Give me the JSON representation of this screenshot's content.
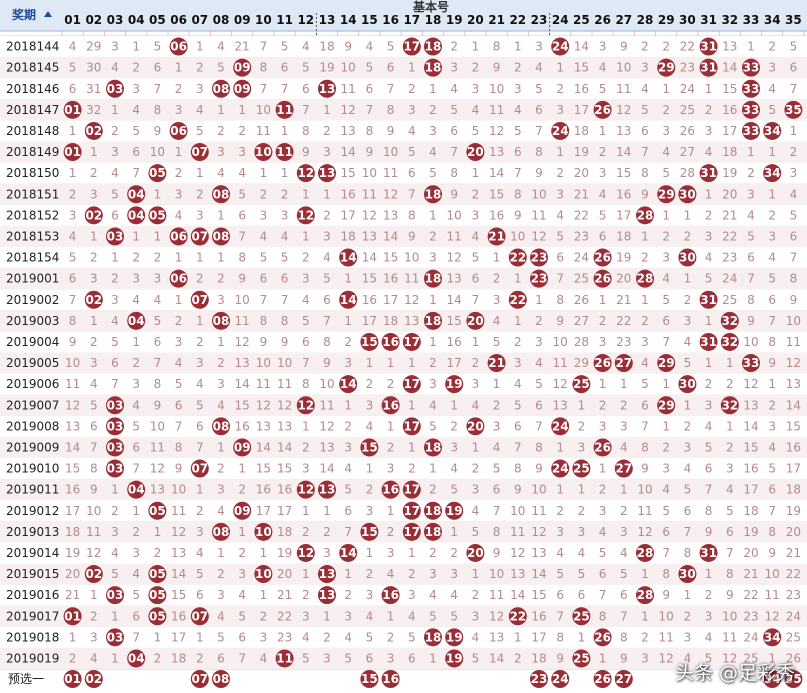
{
  "header": {
    "period_label": "奖期",
    "sort_icon": "sort-asc-icon",
    "base_label": "基本号",
    "columns": [
      "01",
      "02",
      "03",
      "04",
      "05",
      "06",
      "07",
      "08",
      "09",
      "10",
      "11",
      "12",
      "13",
      "14",
      "15",
      "16",
      "17",
      "18",
      "19",
      "20",
      "21",
      "22",
      "23",
      "24",
      "25",
      "26",
      "27",
      "28",
      "29",
      "30",
      "31",
      "32",
      "33",
      "34",
      "35"
    ]
  },
  "colors": {
    "ball": "#9a2e36",
    "header_bg": "#dfe9f6",
    "row_alt": "#f7eff0",
    "miss_text": "#b58a8d"
  },
  "rows": [
    {
      "period": "2018144",
      "cells": [
        4,
        29,
        3,
        1,
        5,
        0,
        1,
        4,
        21,
        7,
        5,
        4,
        18,
        9,
        4,
        5,
        0,
        0,
        2,
        1,
        8,
        1,
        3,
        0,
        14,
        3,
        9,
        2,
        2,
        22,
        0,
        13,
        1,
        2,
        5
      ]
    },
    {
      "period": "2018145",
      "cells": [
        5,
        30,
        4,
        2,
        6,
        1,
        2,
        5,
        0,
        8,
        6,
        5,
        19,
        10,
        5,
        6,
        1,
        0,
        3,
        2,
        9,
        2,
        4,
        1,
        15,
        4,
        10,
        3,
        0,
        23,
        0,
        14,
        0,
        3,
        6
      ]
    },
    {
      "period": "2018146",
      "cells": [
        6,
        31,
        0,
        3,
        7,
        2,
        3,
        0,
        0,
        7,
        7,
        6,
        0,
        11,
        6,
        7,
        2,
        1,
        4,
        3,
        10,
        3,
        5,
        2,
        16,
        5,
        11,
        4,
        1,
        24,
        1,
        15,
        0,
        4,
        7
      ]
    },
    {
      "period": "2018147",
      "cells": [
        0,
        32,
        1,
        4,
        8,
        3,
        4,
        1,
        1,
        10,
        0,
        7,
        1,
        12,
        7,
        8,
        3,
        2,
        5,
        4,
        11,
        4,
        6,
        3,
        17,
        0,
        12,
        5,
        2,
        25,
        2,
        16,
        0,
        5,
        0
      ]
    },
    {
      "period": "2018148",
      "cells": [
        1,
        0,
        2,
        5,
        9,
        0,
        5,
        2,
        2,
        11,
        1,
        8,
        2,
        13,
        8,
        9,
        4,
        3,
        6,
        5,
        12,
        5,
        7,
        0,
        18,
        1,
        13,
        6,
        3,
        26,
        3,
        17,
        0,
        0,
        1
      ]
    },
    {
      "period": "2018149",
      "cells": [
        0,
        1,
        3,
        6,
        10,
        1,
        0,
        3,
        3,
        0,
        0,
        9,
        3,
        14,
        9,
        10,
        5,
        4,
        7,
        0,
        13,
        6,
        8,
        1,
        19,
        2,
        14,
        7,
        4,
        27,
        4,
        18,
        1,
        1,
        2
      ]
    },
    {
      "period": "2018150",
      "cells": [
        1,
        2,
        4,
        7,
        0,
        2,
        1,
        4,
        4,
        1,
        1,
        0,
        0,
        15,
        10,
        11,
        6,
        5,
        8,
        1,
        14,
        7,
        9,
        2,
        20,
        3,
        15,
        8,
        5,
        28,
        0,
        19,
        2,
        0,
        3
      ]
    },
    {
      "period": "2018151",
      "cells": [
        2,
        3,
        5,
        0,
        1,
        3,
        2,
        0,
        5,
        2,
        2,
        1,
        1,
        16,
        11,
        12,
        7,
        0,
        9,
        2,
        15,
        8,
        10,
        3,
        21,
        4,
        16,
        9,
        0,
        0,
        1,
        20,
        3,
        1,
        4
      ]
    },
    {
      "period": "2018152",
      "cells": [
        3,
        0,
        6,
        0,
        0,
        4,
        3,
        1,
        6,
        3,
        3,
        0,
        2,
        17,
        12,
        13,
        8,
        1,
        10,
        3,
        16,
        9,
        11,
        4,
        22,
        5,
        17,
        0,
        1,
        1,
        2,
        21,
        4,
        2,
        5
      ]
    },
    {
      "period": "2018153",
      "cells": [
        4,
        1,
        0,
        1,
        1,
        0,
        0,
        0,
        7,
        4,
        4,
        1,
        3,
        18,
        13,
        14,
        9,
        2,
        11,
        4,
        0,
        10,
        12,
        5,
        23,
        6,
        18,
        1,
        2,
        2,
        3,
        22,
        5,
        3,
        6
      ]
    },
    {
      "period": "2018154",
      "cells": [
        5,
        2,
        1,
        2,
        2,
        1,
        1,
        1,
        8,
        5,
        5,
        2,
        4,
        0,
        14,
        15,
        10,
        3,
        12,
        5,
        1,
        0,
        0,
        6,
        24,
        0,
        19,
        2,
        3,
        0,
        4,
        23,
        6,
        4,
        7
      ]
    },
    {
      "period": "2019001",
      "cells": [
        6,
        3,
        2,
        3,
        3,
        0,
        2,
        2,
        9,
        6,
        6,
        3,
        5,
        1,
        15,
        16,
        11,
        0,
        13,
        6,
        2,
        1,
        0,
        7,
        25,
        0,
        20,
        0,
        4,
        1,
        5,
        24,
        7,
        5,
        8
      ]
    },
    {
      "period": "2019002",
      "cells": [
        7,
        0,
        3,
        4,
        4,
        1,
        0,
        3,
        10,
        7,
        7,
        4,
        6,
        0,
        16,
        17,
        12,
        1,
        14,
        7,
        3,
        0,
        1,
        8,
        26,
        1,
        21,
        1,
        5,
        2,
        0,
        25,
        8,
        6,
        9
      ]
    },
    {
      "period": "2019003",
      "cells": [
        8,
        1,
        4,
        0,
        5,
        2,
        1,
        0,
        11,
        8,
        8,
        5,
        7,
        1,
        17,
        18,
        13,
        0,
        15,
        0,
        4,
        1,
        2,
        9,
        27,
        2,
        22,
        2,
        6,
        3,
        1,
        0,
        9,
        7,
        10
      ]
    },
    {
      "period": "2019004",
      "cells": [
        9,
        2,
        5,
        1,
        6,
        3,
        2,
        1,
        12,
        9,
        9,
        6,
        8,
        2,
        0,
        0,
        0,
        1,
        16,
        1,
        5,
        2,
        3,
        10,
        28,
        3,
        23,
        3,
        7,
        4,
        0,
        0,
        10,
        8,
        11
      ]
    },
    {
      "period": "2019005",
      "cells": [
        10,
        3,
        6,
        2,
        7,
        4,
        3,
        2,
        13,
        10,
        10,
        7,
        9,
        3,
        1,
        1,
        1,
        2,
        17,
        2,
        0,
        3,
        4,
        11,
        29,
        0,
        0,
        4,
        0,
        5,
        1,
        1,
        0,
        9,
        12
      ]
    },
    {
      "period": "2019006",
      "cells": [
        11,
        4,
        7,
        3,
        8,
        5,
        4,
        3,
        14,
        11,
        11,
        8,
        10,
        0,
        2,
        2,
        0,
        3,
        0,
        3,
        1,
        4,
        5,
        12,
        0,
        1,
        1,
        5,
        1,
        0,
        2,
        2,
        12,
        1,
        13
      ]
    },
    {
      "period": "2019007",
      "cells": [
        12,
        5,
        0,
        4,
        9,
        6,
        5,
        4,
        15,
        12,
        12,
        0,
        11,
        1,
        3,
        0,
        1,
        4,
        1,
        4,
        2,
        5,
        6,
        13,
        1,
        2,
        2,
        6,
        0,
        1,
        3,
        0,
        13,
        2,
        14
      ]
    },
    {
      "period": "2019008",
      "cells": [
        13,
        6,
        0,
        5,
        10,
        7,
        6,
        0,
        16,
        13,
        13,
        1,
        12,
        2,
        4,
        1,
        0,
        5,
        2,
        0,
        3,
        6,
        7,
        0,
        2,
        3,
        3,
        7,
        1,
        2,
        4,
        1,
        14,
        3,
        15
      ]
    },
    {
      "period": "2019009",
      "cells": [
        14,
        7,
        0,
        6,
        11,
        8,
        7,
        1,
        0,
        14,
        14,
        2,
        13,
        3,
        0,
        2,
        1,
        0,
        3,
        1,
        4,
        7,
        8,
        1,
        3,
        0,
        4,
        8,
        2,
        3,
        5,
        2,
        15,
        4,
        16
      ]
    },
    {
      "period": "2019010",
      "cells": [
        15,
        8,
        0,
        7,
        12,
        9,
        0,
        2,
        1,
        15,
        15,
        3,
        14,
        4,
        1,
        3,
        2,
        1,
        4,
        2,
        5,
        8,
        9,
        0,
        0,
        1,
        0,
        9,
        3,
        4,
        6,
        3,
        16,
        5,
        17
      ]
    },
    {
      "period": "2019011",
      "cells": [
        16,
        9,
        1,
        0,
        13,
        10,
        1,
        3,
        2,
        16,
        16,
        0,
        0,
        5,
        2,
        0,
        0,
        2,
        5,
        3,
        6,
        9,
        10,
        1,
        1,
        2,
        1,
        10,
        4,
        5,
        7,
        4,
        17,
        6,
        18
      ]
    },
    {
      "period": "2019012",
      "cells": [
        17,
        10,
        2,
        1,
        0,
        11,
        2,
        4,
        0,
        17,
        17,
        1,
        1,
        6,
        3,
        1,
        0,
        0,
        0,
        4,
        7,
        10,
        11,
        2,
        2,
        3,
        2,
        11,
        5,
        6,
        8,
        5,
        18,
        7,
        19
      ]
    },
    {
      "period": "2019013",
      "cells": [
        18,
        11,
        3,
        2,
        1,
        12,
        3,
        0,
        1,
        0,
        18,
        2,
        2,
        7,
        0,
        2,
        0,
        0,
        1,
        5,
        8,
        11,
        12,
        3,
        3,
        4,
        3,
        12,
        6,
        7,
        9,
        6,
        19,
        8,
        20
      ]
    },
    {
      "period": "2019014",
      "cells": [
        19,
        12,
        4,
        3,
        2,
        13,
        4,
        1,
        2,
        1,
        19,
        0,
        3,
        0,
        1,
        3,
        1,
        2,
        2,
        0,
        9,
        12,
        13,
        4,
        4,
        5,
        4,
        0,
        7,
        8,
        0,
        7,
        20,
        9,
        21
      ]
    },
    {
      "period": "2019015",
      "cells": [
        20,
        0,
        5,
        4,
        0,
        14,
        5,
        2,
        3,
        0,
        20,
        1,
        0,
        1,
        2,
        4,
        2,
        3,
        3,
        1,
        10,
        13,
        14,
        5,
        5,
        6,
        5,
        1,
        8,
        0,
        1,
        8,
        21,
        10,
        22
      ]
    },
    {
      "period": "2019016",
      "cells": [
        21,
        1,
        0,
        5,
        0,
        15,
        6,
        3,
        4,
        1,
        21,
        2,
        0,
        2,
        3,
        0,
        3,
        4,
        4,
        2,
        11,
        14,
        15,
        6,
        6,
        7,
        6,
        0,
        9,
        1,
        2,
        9,
        22,
        11,
        23
      ]
    },
    {
      "period": "2019017",
      "cells": [
        0,
        2,
        1,
        6,
        0,
        16,
        0,
        4,
        5,
        2,
        22,
        3,
        1,
        3,
        4,
        1,
        4,
        5,
        5,
        3,
        12,
        0,
        16,
        7,
        0,
        8,
        7,
        1,
        10,
        2,
        3,
        10,
        23,
        12,
        24
      ]
    },
    {
      "period": "2019018",
      "cells": [
        1,
        3,
        0,
        7,
        1,
        17,
        1,
        5,
        6,
        3,
        23,
        4,
        2,
        4,
        5,
        2,
        5,
        0,
        0,
        4,
        13,
        1,
        17,
        8,
        1,
        0,
        8,
        2,
        11,
        3,
        4,
        11,
        24,
        0,
        25
      ]
    },
    {
      "period": "2019019",
      "cells": [
        2,
        4,
        1,
        0,
        2,
        18,
        2,
        6,
        7,
        4,
        0,
        5,
        3,
        5,
        6,
        3,
        6,
        1,
        0,
        5,
        14,
        2,
        18,
        9,
        0,
        1,
        9,
        3,
        12,
        4,
        5,
        12,
        25,
        1,
        26
      ]
    }
  ],
  "forecast": {
    "label": "预选一",
    "numbers": [
      "01",
      "02",
      "07",
      "08",
      "15",
      "16",
      "23",
      "24",
      "26",
      "27",
      "34",
      "35"
    ]
  },
  "watermark": "头条 @足彩秀"
}
